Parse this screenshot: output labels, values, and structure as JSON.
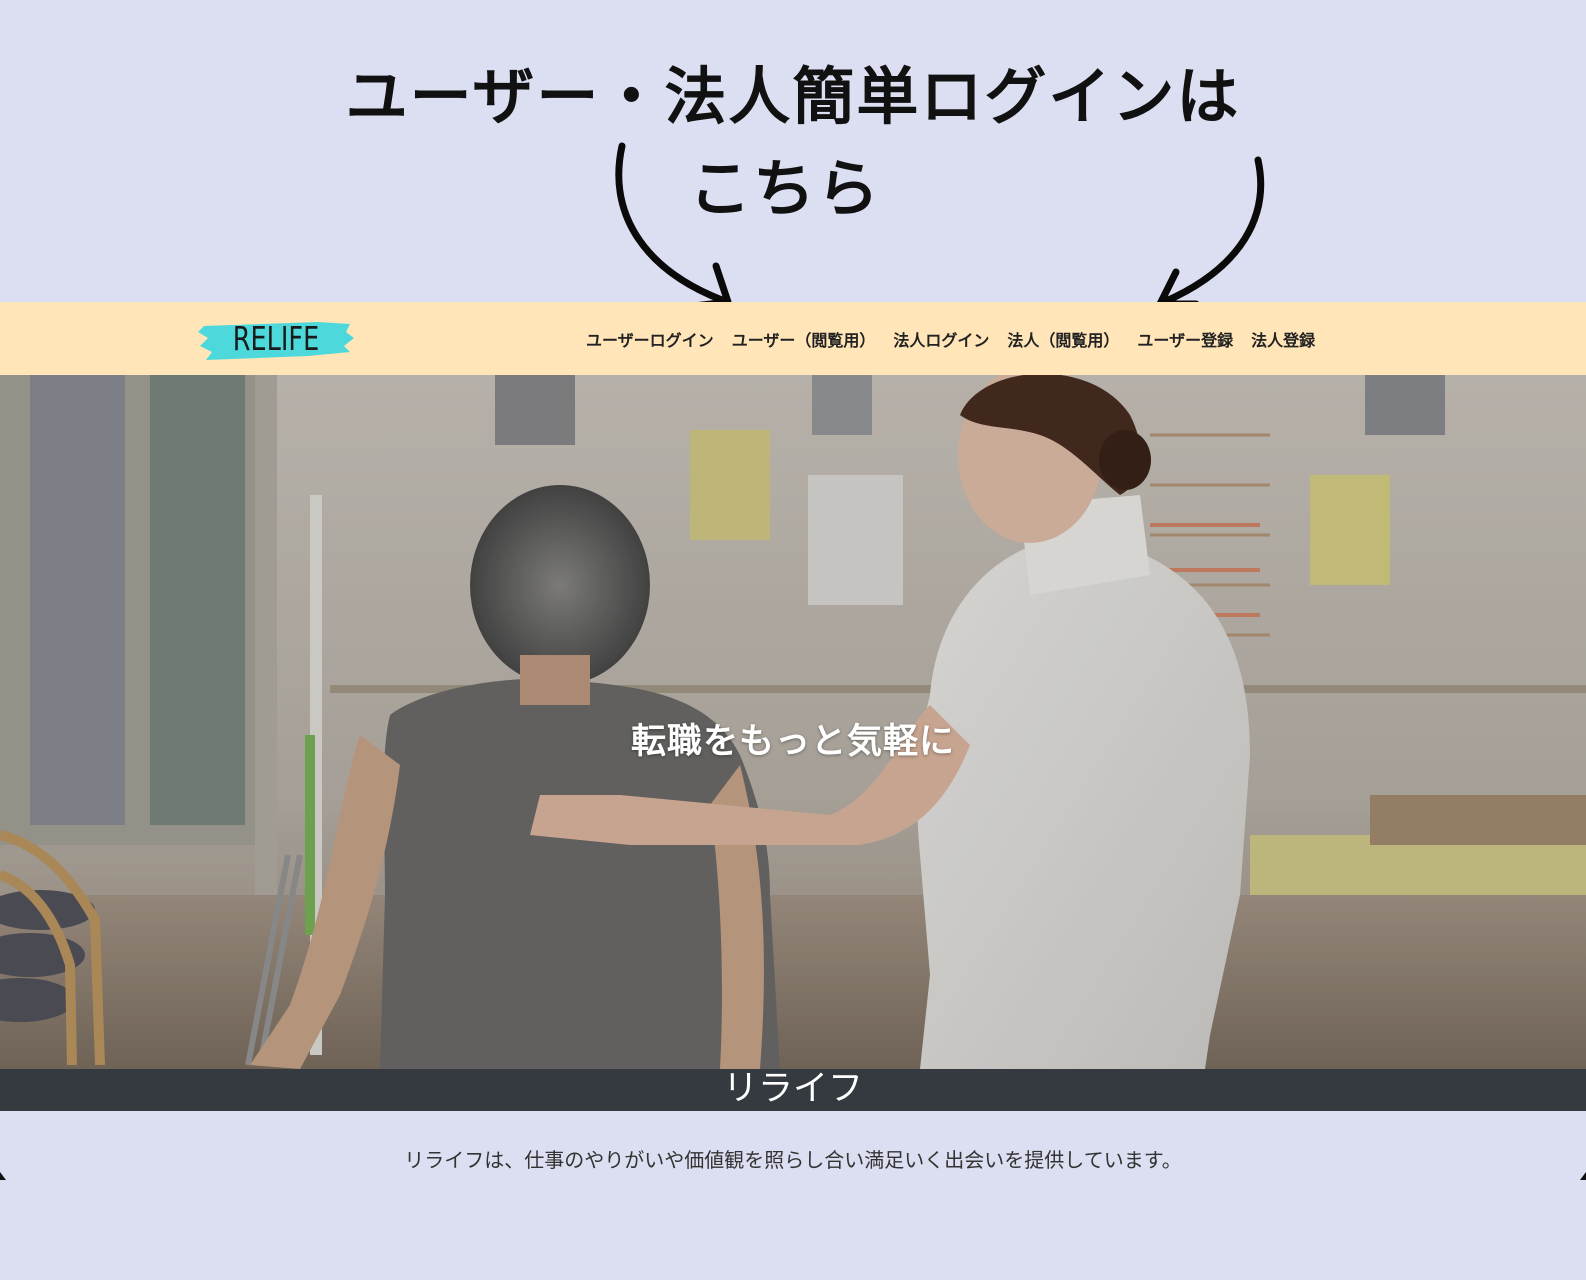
{
  "promo": {
    "line1": "ユーザー・法人簡単ログインは",
    "line2": "こちら"
  },
  "navbar": {
    "logo_text": "RELIFE",
    "links": [
      "ユーザーログイン",
      "ユーザー（閲覧用）",
      "法人ログイン",
      "法人（閲覧用）",
      "ユーザー登録",
      "法人登録"
    ]
  },
  "hero": {
    "caption": "転職をもっと気軽に",
    "image": "nurse-assisting-elderly-woman-photo"
  },
  "site": {
    "name": "リライフ",
    "description": "リライフは、仕事のやりがいや価値観を照らし合い満足いく出会いを提供しています。"
  },
  "colors": {
    "page_background": "#dcdff2",
    "navbar_background": "#ffe5b8",
    "logo_brush": "#4dd9dc",
    "band_background": "#343a40"
  }
}
